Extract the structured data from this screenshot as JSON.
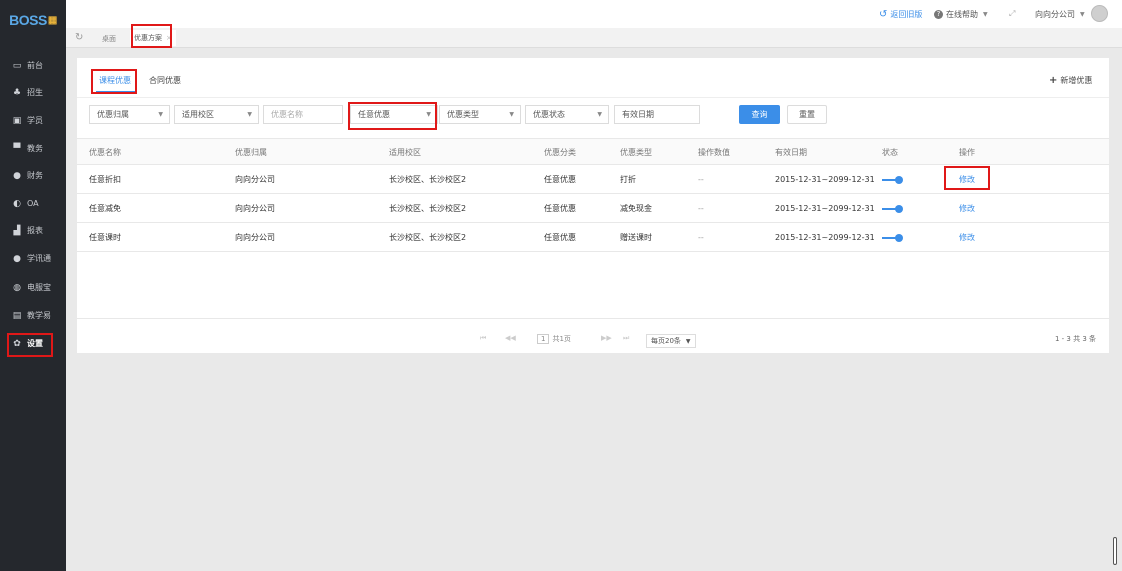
{
  "app": {
    "logo": "BOSS"
  },
  "sidebar": {
    "items": [
      {
        "label": "前台",
        "icon": "monitor-icon",
        "glyph": "▭"
      },
      {
        "label": "招生",
        "icon": "user-group-icon",
        "glyph": "♣"
      },
      {
        "label": "学员",
        "icon": "student-card-icon",
        "glyph": "▣"
      },
      {
        "label": "教务",
        "icon": "book-icon",
        "glyph": "▀"
      },
      {
        "label": "财务",
        "icon": "money-icon",
        "glyph": "●"
      },
      {
        "label": "OA",
        "icon": "toggle-icon",
        "glyph": "◐"
      },
      {
        "label": "报表",
        "icon": "bar-chart-icon",
        "glyph": "▟"
      },
      {
        "label": "学讯通",
        "icon": "message-icon",
        "glyph": "●"
      },
      {
        "label": "电服宝",
        "icon": "phone-icon",
        "glyph": "◍"
      },
      {
        "label": "教学易",
        "icon": "teach-icon",
        "glyph": "▤"
      },
      {
        "label": "设置",
        "icon": "gear-icon",
        "glyph": "✿"
      }
    ]
  },
  "topbar": {
    "back_old": "返回旧版",
    "help": "在线帮助",
    "company": "向向分公司"
  },
  "tabs": {
    "home": "桌面",
    "current": "优惠方案"
  },
  "content": {
    "tab_course": "课程优惠",
    "tab_contract": "合同优惠",
    "add_button": "新增优惠",
    "filters": {
      "owner": "优惠归属",
      "campus": "适用校区",
      "name_placeholder": "优惠名称",
      "category": "任意优惠",
      "type": "优惠类型",
      "status": "优惠状态",
      "date": "有效日期"
    },
    "search_button": "查询",
    "reset_button": "重置",
    "columns": [
      "优惠名称",
      "优惠归属",
      "适用校区",
      "优惠分类",
      "优惠类型",
      "操作数值",
      "有效日期",
      "状态",
      "操作"
    ],
    "rows": [
      {
        "name": "任意折扣",
        "owner": "向向分公司",
        "campus": "长沙校区、长沙校区2",
        "category": "任意优惠",
        "type": "打折",
        "value": "--",
        "date": "2015-12-31~2099-12-31",
        "action": "修改"
      },
      {
        "name": "任意减免",
        "owner": "向向分公司",
        "campus": "长沙校区、长沙校区2",
        "category": "任意优惠",
        "type": "减免现金",
        "value": "--",
        "date": "2015-12-31~2099-12-31",
        "action": "修改"
      },
      {
        "name": "任意课时",
        "owner": "向向分公司",
        "campus": "长沙校区、长沙校区2",
        "category": "任意优惠",
        "type": "赠送课时",
        "value": "--",
        "date": "2015-12-31~2099-12-31",
        "action": "修改"
      }
    ],
    "pagination": {
      "page_input": "1",
      "total_pages": "共1页",
      "per_page": "每页20条",
      "summary": "1 - 3  共 3 条"
    }
  }
}
